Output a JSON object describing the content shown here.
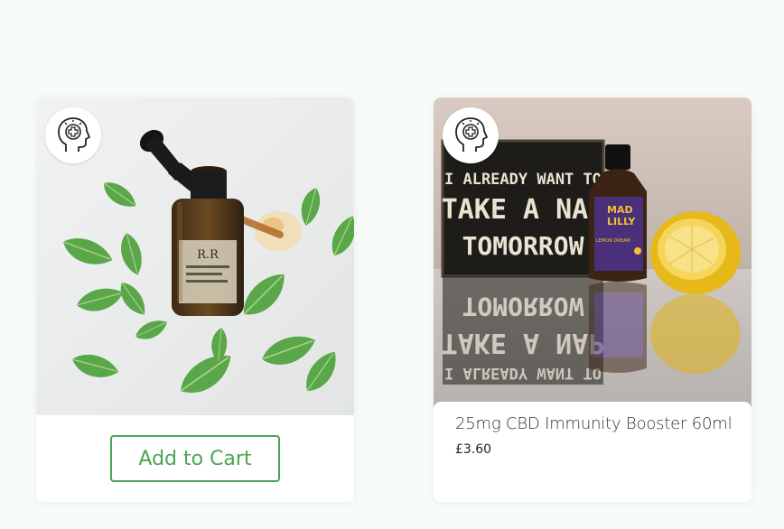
{
  "products": [
    {
      "image_alt": "CBD tincture bottle with dropper surrounded by mint leaves",
      "bottle_label": "R.R",
      "badge_icon": "mental-health-icon",
      "cart_label": "Add to Cart"
    },
    {
      "image_alt": "Mad Lilly bottle beside a sign and a lemon half",
      "badge_icon": "mental-health-icon",
      "sign_lines": [
        "I ALREADY WANT TO",
        "TAKE A NAP",
        "TOMORROW"
      ],
      "bottle_brand": [
        "MAD",
        "LILLY"
      ],
      "bottle_flavor": "LEMON DREAM",
      "title": "25mg CBD Immunity Booster 60ml",
      "price": "£3.60"
    }
  ],
  "colors": {
    "accent": "#4ca454",
    "page_bg": "#f7fcf8"
  }
}
